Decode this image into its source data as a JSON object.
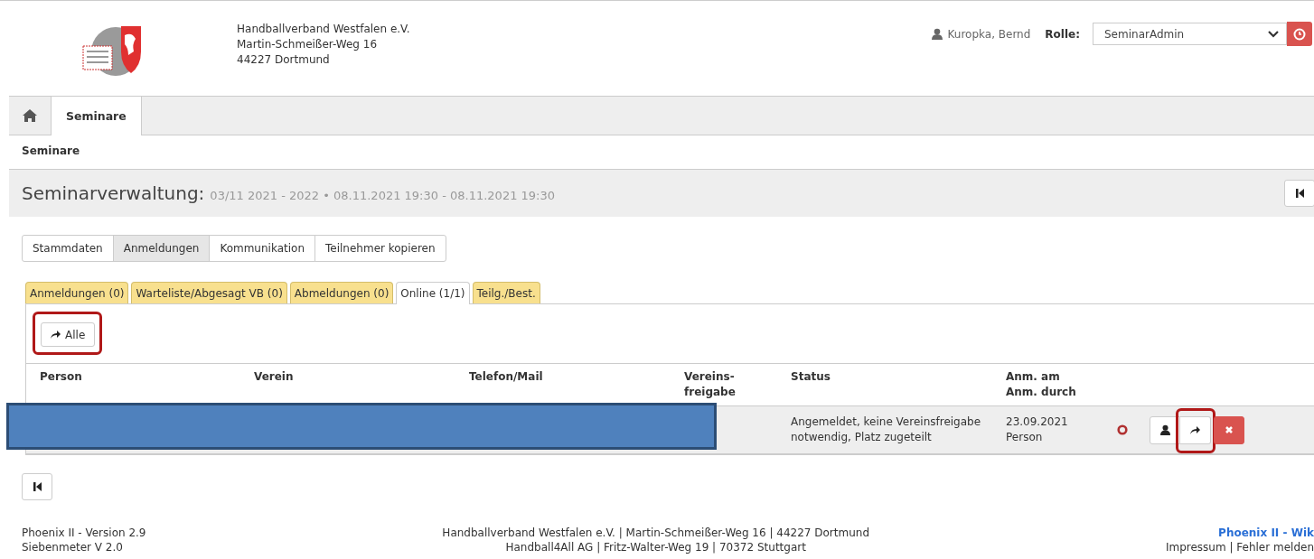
{
  "header": {
    "org_lines": [
      "Handballverband Westfalen e.V.",
      "Martin-Schmeißer-Weg 16",
      "44227 Dortmund"
    ],
    "user_name": "Kuropka, Bernd",
    "role_label": "Rolle:",
    "role_value": "SeminarAdmin"
  },
  "nav_tabs": [
    {
      "kind": "home",
      "selected": false
    },
    {
      "kind": "text",
      "label": "Seminare",
      "selected": true
    }
  ],
  "breadcrumb": "Seminare",
  "page_title": {
    "title": "Seminarverwaltung:",
    "subtitle": "03/11 2021 - 2022 • 08.11.2021 19:30 - 08.11.2021 19:30"
  },
  "section_tabs": [
    {
      "label": "Stammdaten",
      "selected": false
    },
    {
      "label": "Anmeldungen",
      "selected": true
    },
    {
      "label": "Kommunikation",
      "selected": false
    },
    {
      "label": "Teilnehmer kopieren",
      "selected": false
    }
  ],
  "sub_tabs": [
    {
      "label": "Anmeldungen (0)",
      "selected": false
    },
    {
      "label": "Warteliste/Abgesagt VB (0)",
      "selected": false
    },
    {
      "label": "Abmeldungen (0)",
      "selected": false
    },
    {
      "label": "Online (1/1)",
      "selected": true
    },
    {
      "label": "Teilg./Best.",
      "selected": false
    }
  ],
  "all_button": {
    "label": "Alle",
    "highlight": true
  },
  "table": {
    "columns": [
      "Person",
      "Verein",
      "Telefon/Mail",
      "Vereins-\nfreigabe",
      "Status",
      "Anm. am\nAnm. durch"
    ],
    "rows": [
      {
        "redacted": true,
        "status": "Angemeldet, keine Vereinsfreigabe notwendig, Platz zugeteilt",
        "date": "23.09.2021",
        "by": "Person",
        "actions": [
          {
            "kind": "status",
            "highlight": false
          },
          {
            "kind": "person",
            "highlight": false
          },
          {
            "kind": "forward",
            "highlight": true
          },
          {
            "kind": "delete",
            "highlight": false
          }
        ]
      }
    ]
  },
  "footer": {
    "left": [
      "Phoenix II - Version 2.9",
      "Siebenmeter V 2.0"
    ],
    "center": [
      "Handballverband Westfalen e.V. | Martin-Schmeißer-Weg 16 | 44227 Dortmund",
      "Handball4All AG | Fritz-Walter-Weg 19 | 70372 Stuttgart"
    ],
    "right_link": "Phoenix II - Wik",
    "right_text": "Impressum | Fehler melden"
  }
}
